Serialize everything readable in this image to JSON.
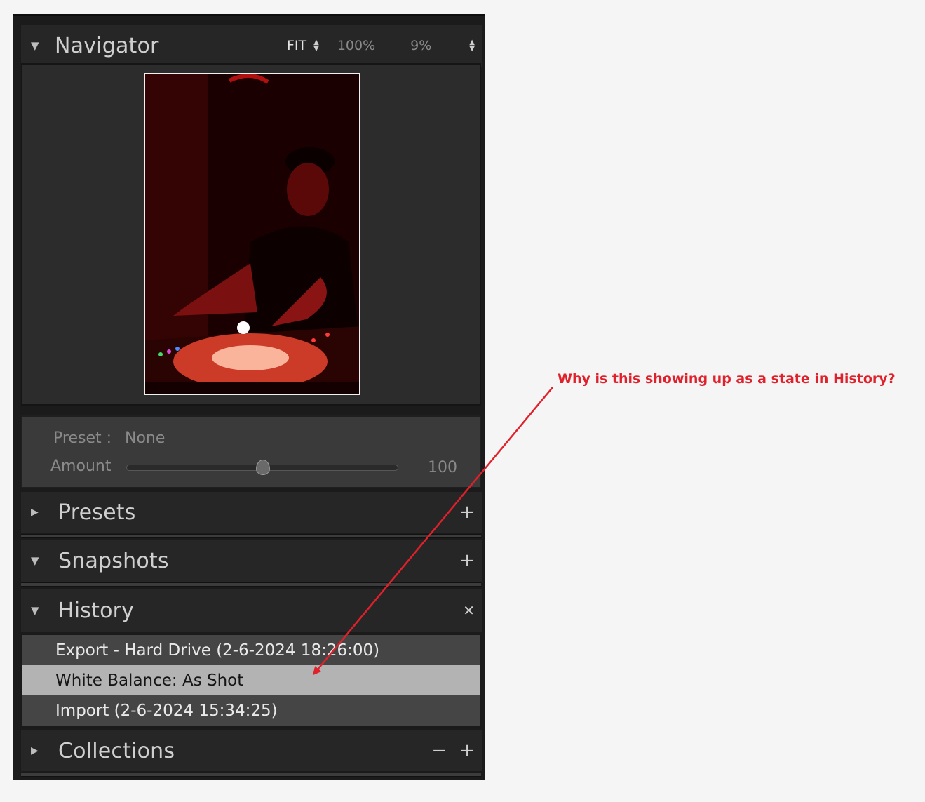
{
  "navigator": {
    "title": "Navigator",
    "zoom_fit": "FIT",
    "zoom_100": "100%",
    "zoom_custom": "9%"
  },
  "preset": {
    "label": "Preset :",
    "value": "None",
    "amount_label": "Amount",
    "amount_value": "100",
    "amount_level": 0.5
  },
  "presets": {
    "title": "Presets"
  },
  "snapshots": {
    "title": "Snapshots"
  },
  "history": {
    "title": "History",
    "items": [
      "Export - Hard Drive (2-6-2024 18:26:00)",
      "White Balance: As Shot",
      "Import (2-6-2024 15:34:25)"
    ],
    "selected_index": 1
  },
  "collections": {
    "title": "Collections"
  },
  "annotation": {
    "text": "Why is this showing up as a state in History?",
    "color": "#e0202a"
  },
  "icons": {
    "collapse": "triangle-down-icon",
    "expand": "triangle-right-icon",
    "add": "plus-icon",
    "remove": "minus-icon",
    "clear": "close-icon"
  }
}
